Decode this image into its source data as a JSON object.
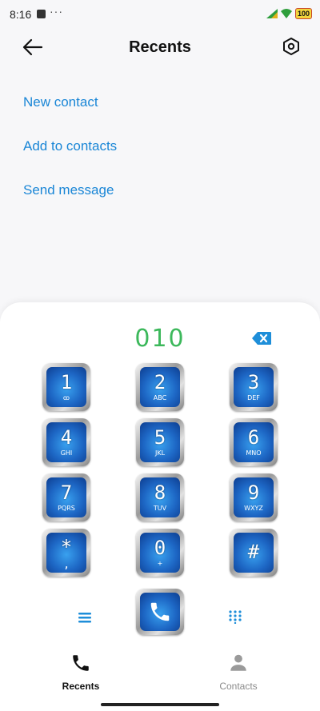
{
  "status_bar": {
    "time": "8:16",
    "dots": "···",
    "battery": "100"
  },
  "header": {
    "title": "Recents"
  },
  "options": [
    {
      "label": "New contact"
    },
    {
      "label": "Add to contacts"
    },
    {
      "label": "Send message"
    }
  ],
  "dialer": {
    "number": "010",
    "keys": [
      {
        "digit": "1",
        "letters": "ꝏ"
      },
      {
        "digit": "2",
        "letters": "ABC"
      },
      {
        "digit": "3",
        "letters": "DEF"
      },
      {
        "digit": "4",
        "letters": "GHI"
      },
      {
        "digit": "5",
        "letters": "JKL"
      },
      {
        "digit": "6",
        "letters": "MNO"
      },
      {
        "digit": "7",
        "letters": "PQRS"
      },
      {
        "digit": "8",
        "letters": "TUV"
      },
      {
        "digit": "9",
        "letters": "WXYZ"
      },
      {
        "digit": "*",
        "letters": ","
      },
      {
        "digit": "0",
        "letters": "+"
      },
      {
        "digit": "#",
        "letters": ""
      }
    ]
  },
  "bottom_nav": {
    "recents_label": "Recents",
    "contacts_label": "Contacts"
  },
  "colors": {
    "accent_blue": "#1a86d6",
    "number_green": "#3cb85b",
    "key_blue": "#1d66c4"
  }
}
